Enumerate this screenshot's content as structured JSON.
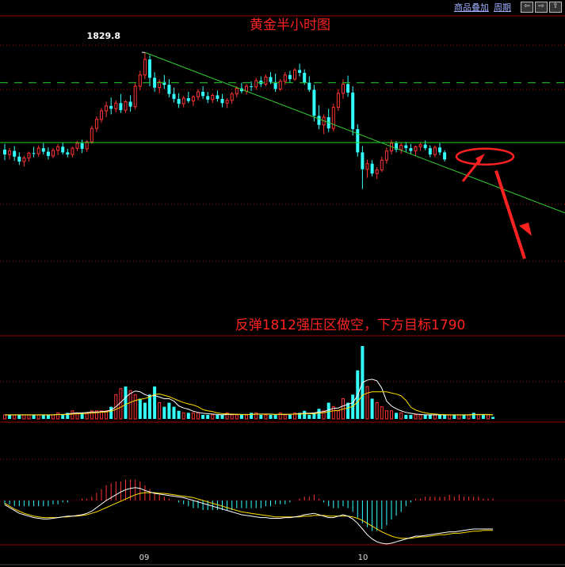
{
  "toolbar": {
    "overlay_label": "商品叠加",
    "period_label": "周期",
    "buttons": [
      "⇦",
      "⇨",
      "⇧"
    ]
  },
  "chart_data": {
    "type": "candlestick",
    "title": "黄金半小时图",
    "annotation": "反弹1812强压区做空，下方目标1790",
    "high_label": "1829.8",
    "x_tick_labels": [
      "09",
      "10"
    ],
    "colors": {
      "up": "#ff3333",
      "down": "#33ffff",
      "trendline": "#33cc33",
      "support_line": "#22dd22",
      "dashed_line": "#22bb22",
      "annotation": "#ff2222",
      "grid": "#a00000",
      "ma_short": "#ffffff",
      "ma_long": "#ffdd00"
    },
    "price": {
      "candles": [
        [
          1816.0,
          1816.8,
          1814.5,
          1815.3
        ],
        [
          1815.3,
          1816.2,
          1814.6,
          1815.8
        ],
        [
          1815.8,
          1816.5,
          1814.4,
          1815.0
        ],
        [
          1815.0,
          1815.6,
          1813.8,
          1814.3
        ],
        [
          1814.3,
          1815.1,
          1813.6,
          1814.8
        ],
        [
          1814.8,
          1815.7,
          1814.3,
          1815.5
        ],
        [
          1815.5,
          1816.4,
          1814.9,
          1815.4
        ],
        [
          1815.4,
          1816.6,
          1815.0,
          1816.2
        ],
        [
          1816.2,
          1816.9,
          1815.3,
          1815.7
        ],
        [
          1815.7,
          1816.3,
          1814.6,
          1815.1
        ],
        [
          1815.1,
          1816.2,
          1814.8,
          1815.9
        ],
        [
          1815.9,
          1816.8,
          1815.2,
          1816.4
        ],
        [
          1816.4,
          1817.0,
          1815.3,
          1815.6
        ],
        [
          1815.6,
          1816.1,
          1814.9,
          1815.3
        ],
        [
          1815.3,
          1816.4,
          1814.9,
          1816.2
        ],
        [
          1816.2,
          1817.2,
          1815.8,
          1816.9
        ],
        [
          1816.9,
          1817.4,
          1815.5,
          1816.1
        ],
        [
          1816.1,
          1817.3,
          1815.7,
          1817.1
        ],
        [
          1817.1,
          1819.4,
          1816.8,
          1819.0
        ],
        [
          1819.0,
          1820.7,
          1818.5,
          1820.3
        ],
        [
          1820.3,
          1821.9,
          1819.8,
          1821.5
        ],
        [
          1821.5,
          1822.8,
          1820.6,
          1822.2
        ],
        [
          1822.2,
          1823.4,
          1821.0,
          1821.8
        ],
        [
          1821.8,
          1823.0,
          1821.3,
          1822.6
        ],
        [
          1822.6,
          1823.9,
          1821.2,
          1821.6
        ],
        [
          1821.6,
          1823.0,
          1821.2,
          1822.8
        ],
        [
          1822.8,
          1823.7,
          1821.4,
          1822.1
        ],
        [
          1822.1,
          1825.5,
          1821.7,
          1825.0
        ],
        [
          1825.0,
          1827.2,
          1824.4,
          1826.6
        ],
        [
          1826.6,
          1829.8,
          1826.0,
          1828.8
        ],
        [
          1828.8,
          1829.4,
          1825.0,
          1826.2
        ],
        [
          1826.2,
          1827.0,
          1824.2,
          1824.8
        ],
        [
          1824.8,
          1826.0,
          1824.0,
          1825.6
        ],
        [
          1825.6,
          1826.6,
          1824.6,
          1825.2
        ],
        [
          1825.2,
          1826.0,
          1823.4,
          1823.9
        ],
        [
          1823.9,
          1824.8,
          1822.7,
          1823.2
        ],
        [
          1823.2,
          1824.0,
          1821.9,
          1822.5
        ],
        [
          1822.5,
          1823.6,
          1822.0,
          1823.3
        ],
        [
          1823.3,
          1824.2,
          1822.6,
          1822.9
        ],
        [
          1822.9,
          1823.7,
          1822.2,
          1823.5
        ],
        [
          1823.5,
          1824.6,
          1823.0,
          1824.2
        ],
        [
          1824.2,
          1825.0,
          1823.2,
          1823.6
        ],
        [
          1823.6,
          1824.2,
          1822.6,
          1823.1
        ],
        [
          1823.1,
          1824.0,
          1822.6,
          1823.7
        ],
        [
          1823.7,
          1824.4,
          1822.8,
          1823.2
        ],
        [
          1823.2,
          1823.9,
          1822.0,
          1822.6
        ],
        [
          1822.6,
          1823.3,
          1821.9,
          1823.0
        ],
        [
          1823.0,
          1824.2,
          1822.5,
          1823.9
        ],
        [
          1823.9,
          1825.0,
          1823.4,
          1824.7
        ],
        [
          1824.7,
          1825.5,
          1824.0,
          1824.3
        ],
        [
          1824.3,
          1825.3,
          1823.8,
          1825.0
        ],
        [
          1825.0,
          1825.7,
          1824.3,
          1824.9
        ],
        [
          1824.9,
          1826.2,
          1824.5,
          1825.8
        ],
        [
          1825.8,
          1826.4,
          1824.9,
          1825.3
        ],
        [
          1825.3,
          1826.7,
          1825.0,
          1826.3
        ],
        [
          1826.3,
          1827.0,
          1825.3,
          1825.6
        ],
        [
          1825.6,
          1826.8,
          1824.2,
          1824.6
        ],
        [
          1824.6,
          1826.0,
          1824.3,
          1825.7
        ],
        [
          1825.7,
          1827.0,
          1825.2,
          1826.6
        ],
        [
          1826.6,
          1827.2,
          1825.5,
          1826.0
        ],
        [
          1826.0,
          1827.6,
          1825.8,
          1827.3
        ],
        [
          1827.3,
          1828.2,
          1826.4,
          1826.9
        ],
        [
          1826.9,
          1827.4,
          1825.2,
          1825.5
        ],
        [
          1825.5,
          1826.4,
          1824.2,
          1824.5
        ],
        [
          1824.5,
          1825.2,
          1820.0,
          1820.8
        ],
        [
          1820.8,
          1822.3,
          1818.9,
          1819.5
        ],
        [
          1819.5,
          1821.0,
          1818.2,
          1820.6
        ],
        [
          1820.6,
          1821.8,
          1818.5,
          1819.0
        ],
        [
          1819.0,
          1822.5,
          1818.6,
          1822.0
        ],
        [
          1822.0,
          1824.6,
          1821.5,
          1824.0
        ],
        [
          1824.0,
          1826.0,
          1823.2,
          1825.3
        ],
        [
          1825.3,
          1826.5,
          1823.5,
          1824.1
        ],
        [
          1824.1,
          1825.0,
          1818.0,
          1818.9
        ],
        [
          1818.9,
          1819.6,
          1815.0,
          1815.6
        ],
        [
          1815.6,
          1816.5,
          1810.4,
          1813.2
        ],
        [
          1813.2,
          1814.6,
          1812.0,
          1814.0
        ],
        [
          1814.0,
          1814.5,
          1812.2,
          1812.6
        ],
        [
          1812.6,
          1813.5,
          1811.8,
          1813.1
        ],
        [
          1813.1,
          1815.0,
          1812.8,
          1814.5
        ],
        [
          1814.5,
          1816.3,
          1814.0,
          1815.8
        ],
        [
          1815.8,
          1817.4,
          1815.3,
          1816.9
        ],
        [
          1816.9,
          1817.2,
          1815.6,
          1816.0
        ],
        [
          1816.0,
          1817.0,
          1815.4,
          1816.6
        ],
        [
          1816.6,
          1817.1,
          1815.6,
          1816.2
        ],
        [
          1816.2,
          1816.8,
          1815.3,
          1815.8
        ],
        [
          1815.8,
          1816.6,
          1815.1,
          1816.4
        ],
        [
          1816.4,
          1817.0,
          1815.8,
          1816.7
        ],
        [
          1816.7,
          1817.3,
          1815.9,
          1816.2
        ],
        [
          1816.2,
          1816.6,
          1814.9,
          1815.3
        ],
        [
          1815.3,
          1816.6,
          1814.9,
          1816.3
        ],
        [
          1816.3,
          1816.9,
          1815.2,
          1815.6
        ],
        [
          1815.6,
          1815.9,
          1814.3,
          1814.6
        ]
      ]
    },
    "volume": {
      "values": [
        2,
        2,
        2,
        2,
        2,
        2,
        2,
        2,
        2,
        2,
        2,
        3,
        2,
        3,
        4,
        3,
        3,
        3,
        4,
        4,
        4,
        4,
        6,
        12,
        15,
        16,
        14,
        12,
        10,
        8,
        12,
        16,
        8,
        6,
        8,
        6,
        4,
        3,
        3,
        3,
        3,
        2,
        2,
        2,
        2,
        2,
        3,
        2,
        2,
        2,
        2,
        3,
        3,
        2,
        2,
        2,
        2,
        3,
        2,
        2,
        3,
        3,
        4,
        2,
        3,
        5,
        4,
        8,
        6,
        4,
        10,
        8,
        12,
        24,
        36,
        16,
        10,
        8,
        6,
        4,
        4,
        3,
        3,
        2,
        2,
        2,
        2,
        2,
        2,
        2,
        2,
        2,
        2,
        2,
        2,
        2,
        2,
        3,
        2,
        2,
        2,
        1
      ],
      "up_flags": [
        true,
        false,
        true,
        false,
        true,
        true,
        false,
        true,
        false,
        false,
        true,
        true,
        false,
        false,
        true,
        true,
        false,
        true,
        true,
        true,
        true,
        true,
        false,
        true,
        true,
        false,
        true,
        true,
        false,
        false,
        false,
        false,
        true,
        false,
        false,
        false,
        false,
        true,
        false,
        true,
        true,
        false,
        false,
        true,
        false,
        false,
        true,
        true,
        true,
        false,
        true,
        false,
        true,
        false,
        true,
        false,
        false,
        true,
        true,
        false,
        true,
        false,
        false,
        false,
        false,
        false,
        true,
        false,
        true,
        true,
        true,
        false,
        false,
        false,
        false,
        true,
        false,
        true,
        true,
        true,
        true,
        false,
        true,
        false,
        false,
        true,
        true,
        false,
        false,
        true,
        false,
        false,
        true,
        false,
        true,
        false,
        true,
        false,
        true,
        false,
        true,
        false
      ]
    },
    "macd": {
      "white_line": [
        -6,
        -10,
        -14,
        -18,
        -20,
        -22,
        -24,
        -25,
        -26,
        -26,
        -25,
        -24,
        -23,
        -22,
        -22,
        -21,
        -20,
        -18,
        -15,
        -10,
        -5,
        0,
        4,
        8,
        12,
        15,
        17,
        18,
        17,
        14,
        12,
        10,
        9,
        8,
        7,
        6,
        5,
        4,
        2,
        0,
        -2,
        -4,
        -6,
        -8,
        -10,
        -12,
        -14,
        -16,
        -18,
        -20,
        -21,
        -22,
        -23,
        -24,
        -24,
        -25,
        -25,
        -25,
        -24,
        -24,
        -23,
        -22,
        -20,
        -19,
        -18,
        -20,
        -22,
        -24,
        -24,
        -22,
        -20,
        -22,
        -26,
        -32,
        -40,
        -48,
        -54,
        -58,
        -60,
        -61,
        -60,
        -58,
        -56,
        -54,
        -52,
        -50,
        -50,
        -49,
        -48,
        -47,
        -46,
        -45,
        -44,
        -44,
        -43,
        -42,
        -41,
        -40,
        -40,
        -40,
        -40,
        -40
      ],
      "yellow_line": [
        -4,
        -8,
        -12,
        -15,
        -18,
        -20,
        -22,
        -23,
        -24,
        -24,
        -24,
        -24,
        -23,
        -23,
        -22,
        -22,
        -21,
        -20,
        -18,
        -16,
        -13,
        -10,
        -7,
        -4,
        -1,
        2,
        5,
        8,
        10,
        11,
        11,
        11,
        10,
        10,
        9,
        8,
        7,
        6,
        5,
        4,
        2,
        0,
        -2,
        -4,
        -6,
        -8,
        -10,
        -12,
        -14,
        -16,
        -17,
        -18,
        -19,
        -20,
        -21,
        -22,
        -23,
        -23,
        -23,
        -23,
        -23,
        -23,
        -22,
        -22,
        -21,
        -21,
        -21,
        -22,
        -22,
        -22,
        -22,
        -22,
        -23,
        -25,
        -28,
        -32,
        -36,
        -40,
        -44,
        -47,
        -50,
        -52,
        -53,
        -53,
        -53,
        -52,
        -51,
        -51,
        -50,
        -49,
        -48,
        -48,
        -47,
        -46,
        -46,
        -45,
        -44,
        -43,
        -43,
        -42,
        -42,
        -42
      ],
      "histogram": [
        -2,
        -2,
        -3,
        -3,
        -3,
        -3,
        -3,
        -3,
        -3,
        -3,
        -2,
        -2,
        -1,
        -1,
        0,
        0,
        1,
        1,
        2,
        4,
        6,
        8,
        9,
        10,
        10,
        11,
        11,
        11,
        10,
        8,
        6,
        4,
        3,
        2,
        1,
        0,
        -1,
        -2,
        -3,
        -4,
        -4,
        -5,
        -5,
        -5,
        -5,
        -5,
        -5,
        -5,
        -4,
        -4,
        -4,
        -4,
        -4,
        -4,
        -3,
        -3,
        -2,
        -2,
        -2,
        -1,
        0,
        1,
        2,
        2,
        3,
        1,
        -1,
        -3,
        -4,
        -4,
        -3,
        -4,
        -6,
        -9,
        -12,
        -14,
        -16,
        -16,
        -15,
        -13,
        -10,
        -8,
        -6,
        -3,
        -1,
        1,
        1,
        2,
        2,
        2,
        2,
        2,
        3,
        2,
        3,
        2,
        2,
        2,
        2,
        1,
        1,
        1
      ]
    }
  }
}
